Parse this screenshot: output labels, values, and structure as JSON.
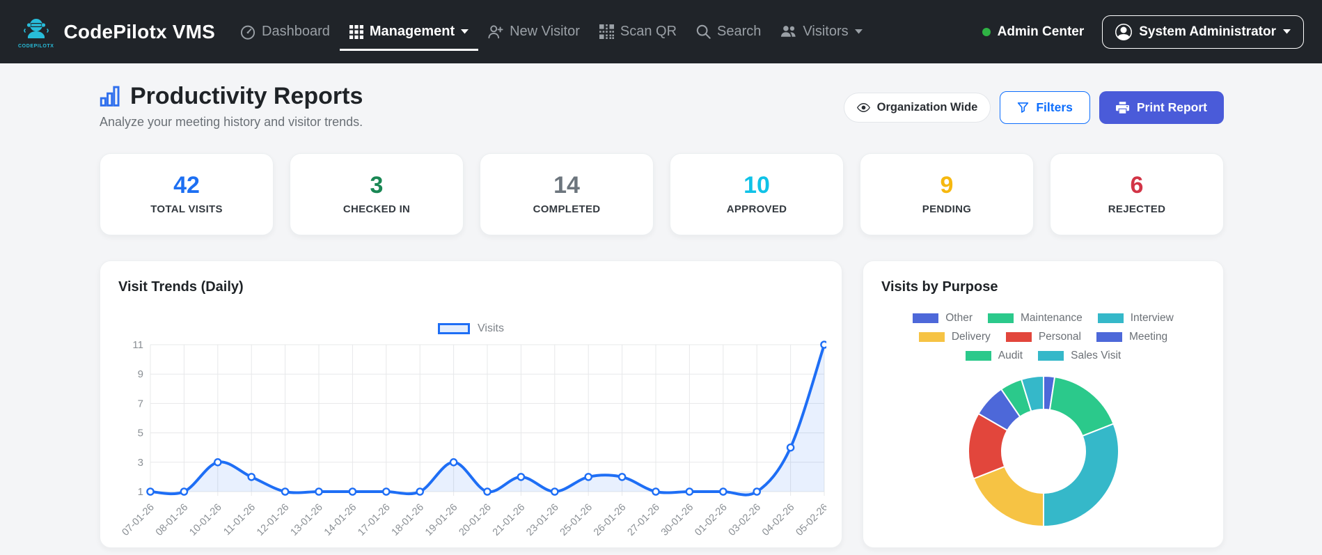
{
  "navbar": {
    "brand": "CodePilotx VMS",
    "logo_text": "CODEPILOTX",
    "logo_color": "#28bcd9",
    "items": [
      {
        "label": "Dashboard",
        "icon": "speedometer",
        "active": false,
        "caret": false
      },
      {
        "label": "Management",
        "icon": "grid",
        "active": true,
        "caret": true
      },
      {
        "label": "New Visitor",
        "icon": "person-plus",
        "active": false,
        "caret": false
      },
      {
        "label": "Scan QR",
        "icon": "qr-code",
        "active": false,
        "caret": false
      },
      {
        "label": "Search",
        "icon": "search",
        "active": false,
        "caret": false
      },
      {
        "label": "Visitors",
        "icon": "people",
        "active": false,
        "caret": true
      }
    ],
    "status": {
      "label": "Admin Center",
      "dot_color": "#2fb344"
    },
    "user_menu": {
      "label": "System Administrator",
      "icon": "person-circle"
    }
  },
  "header": {
    "title": "Productivity Reports",
    "subtitle": "Analyze your meeting history and visitor trends.",
    "title_icon_color": "#2f6fed",
    "scope_button": "Organization Wide",
    "filters_button": "Filters",
    "print_button": "Print Report"
  },
  "stats": [
    {
      "value": "42",
      "label": "TOTAL VISITS",
      "color": "#1d6ff2"
    },
    {
      "value": "3",
      "label": "CHECKED IN",
      "color": "#198754"
    },
    {
      "value": "14",
      "label": "COMPLETED",
      "color": "#6c757d"
    },
    {
      "value": "10",
      "label": "APPROVED",
      "color": "#0fc2e7"
    },
    {
      "value": "9",
      "label": "PENDING",
      "color": "#f6b80f"
    },
    {
      "value": "6",
      "label": "REJECTED",
      "color": "#d23446"
    }
  ],
  "chart_data": [
    {
      "type": "line",
      "title": "Visit Trends (Daily)",
      "legend": "Visits",
      "legend_position": "top",
      "x": [
        "07-01-26",
        "08-01-26",
        "10-01-26",
        "11-01-26",
        "12-01-26",
        "13-01-26",
        "14-01-26",
        "17-01-26",
        "18-01-26",
        "19-01-26",
        "20-01-26",
        "21-01-26",
        "23-01-26",
        "25-01-26",
        "26-01-26",
        "27-01-26",
        "30-01-26",
        "01-02-26",
        "03-02-26",
        "04-02-26",
        "05-02-26"
      ],
      "values": [
        1,
        1,
        3,
        2,
        1,
        1,
        1,
        1,
        1,
        3,
        1,
        2,
        1,
        2,
        2,
        1,
        1,
        1,
        1,
        4,
        11
      ],
      "yticks": [
        1,
        3,
        5,
        7,
        9,
        11
      ],
      "ylim": [
        1,
        11
      ],
      "grid": true,
      "line_color": "#1e6ef5",
      "fill_color": "rgba(30,110,245,0.10)",
      "point_fill": "#ffffff"
    },
    {
      "type": "pie",
      "subtype": "donut",
      "title": "Visits by Purpose",
      "legend_position": "top",
      "legend_rows": [
        [
          "Other",
          "Maintenance",
          "Interview"
        ],
        [
          "Delivery",
          "Personal",
          "Meeting"
        ],
        [
          "Audit",
          "Sales Visit"
        ]
      ],
      "segments": [
        {
          "label": "Other",
          "value": 1,
          "color": "#4d68d9"
        },
        {
          "label": "Maintenance",
          "value": 7,
          "color": "#2bc98b"
        },
        {
          "label": "Interview",
          "value": 13,
          "color": "#35b8c9"
        },
        {
          "label": "Delivery",
          "value": 8,
          "color": "#f6c344"
        },
        {
          "label": "Personal",
          "value": 6,
          "color": "#e2463c"
        },
        {
          "label": "Meeting",
          "value": 3,
          "color": "#4d68d9"
        },
        {
          "label": "Audit",
          "value": 2,
          "color": "#2bc98b"
        },
        {
          "label": "Sales Visit",
          "value": 2,
          "color": "#35b8c9"
        }
      ],
      "total": 42
    }
  ]
}
